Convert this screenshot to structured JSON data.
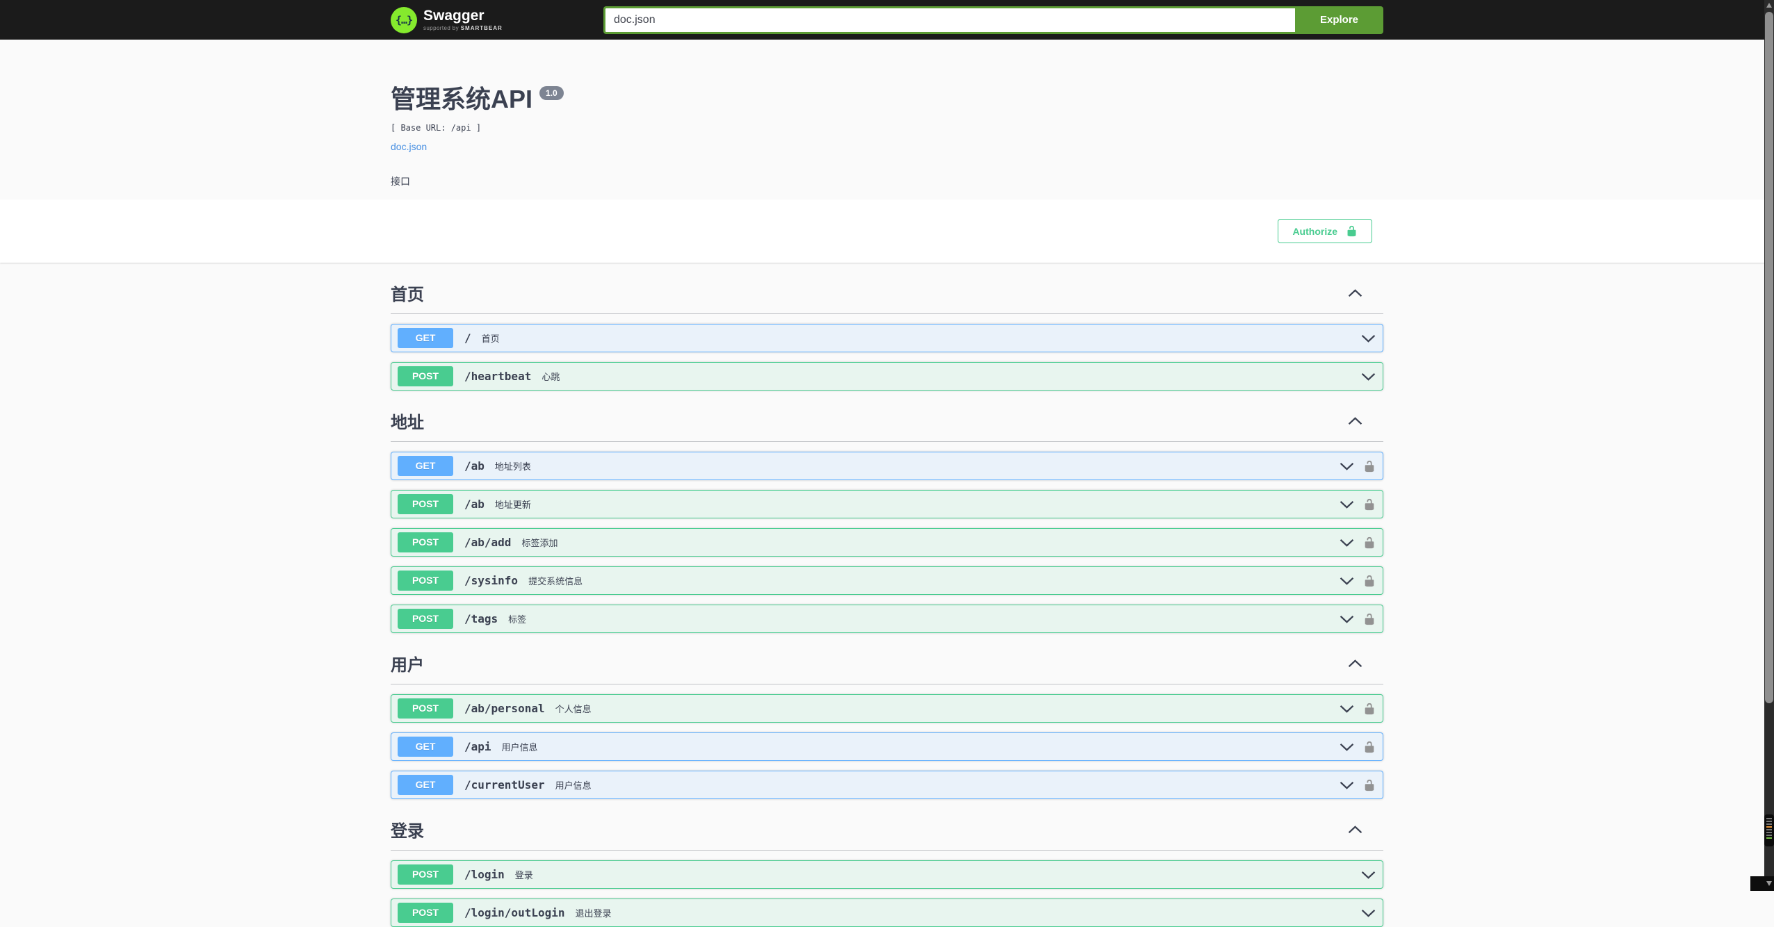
{
  "topbar": {
    "logo": {
      "text": "Swagger",
      "tagline_prefix": "supported by",
      "tagline_brand": "SMARTBEAR",
      "mark_glyph": "{…}"
    },
    "search": {
      "value": "doc.json"
    },
    "explore_button": "Explore"
  },
  "info": {
    "title": "管理系统API",
    "version_badge": "1.0",
    "base_url": "[ Base URL: /api ]",
    "spec_link": "doc.json",
    "description": "接口"
  },
  "auth": {
    "authorize_button": "Authorize"
  },
  "icons": {
    "row_expand": "chevron-down",
    "section_collapse": "chevron-up",
    "auth_lock": "unlocked-padlock"
  },
  "colors": {
    "topbar_bg": "#1b1b1b",
    "green_button": "#5c9c34",
    "logo_green": "#85ea2d",
    "get_blue": "#61affe",
    "post_green": "#49cc90",
    "link_blue": "#4990e2",
    "text": "#3b4151",
    "version_badge_bg": "#7d8492",
    "lock_gray": "#929292"
  },
  "sections": [
    {
      "title": "首页",
      "expanded": true,
      "endpoints": [
        {
          "method": "GET",
          "path": "/",
          "summary": "首页",
          "has_lock": false
        },
        {
          "method": "POST",
          "path": "/heartbeat",
          "summary": "心跳",
          "has_lock": false
        }
      ]
    },
    {
      "title": "地址",
      "expanded": true,
      "endpoints": [
        {
          "method": "GET",
          "path": "/ab",
          "summary": "地址列表",
          "has_lock": true
        },
        {
          "method": "POST",
          "path": "/ab",
          "summary": "地址更新",
          "has_lock": true
        },
        {
          "method": "POST",
          "path": "/ab/add",
          "summary": "标签添加",
          "has_lock": true
        },
        {
          "method": "POST",
          "path": "/sysinfo",
          "summary": "提交系统信息",
          "has_lock": true
        },
        {
          "method": "POST",
          "path": "/tags",
          "summary": "标签",
          "has_lock": true
        }
      ]
    },
    {
      "title": "用户",
      "expanded": true,
      "endpoints": [
        {
          "method": "POST",
          "path": "/ab/personal",
          "summary": "个人信息",
          "has_lock": true
        },
        {
          "method": "GET",
          "path": "/api",
          "summary": "用户信息",
          "has_lock": true
        },
        {
          "method": "GET",
          "path": "/currentUser",
          "summary": "用户信息",
          "has_lock": true
        }
      ]
    },
    {
      "title": "登录",
      "expanded": true,
      "endpoints": [
        {
          "method": "POST",
          "path": "/login",
          "summary": "登录",
          "has_lock": false
        },
        {
          "method": "POST",
          "path": "/login/outLogin",
          "summary": "退出登录",
          "has_lock": false
        }
      ]
    }
  ]
}
